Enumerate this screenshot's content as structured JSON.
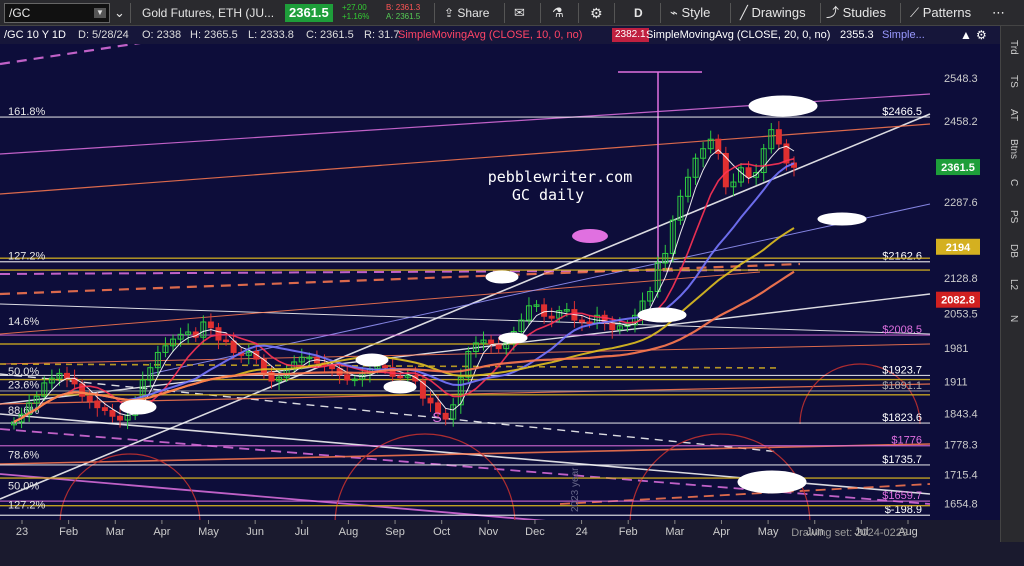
{
  "toolbar": {
    "symbol": "/GC",
    "instrument_name": "Gold Futures, ETH (JU...",
    "last_price": "2361.5",
    "change": "+27.00",
    "change_pct": "+1.16%",
    "bid": "B: 2361.3",
    "ask": "A: 2361.5",
    "share_label": "Share",
    "period_label": "D",
    "style_label": "Style",
    "drawings_label": "Drawings",
    "studies_label": "Studies",
    "patterns_label": "Patterns"
  },
  "study_bar": {
    "symbol_period": "/GC 10 Y 1D",
    "date": "D: 5/28/24",
    "open": "O: 2338",
    "high": "H: 2365.5",
    "low": "L: 2333.8",
    "close": "C: 2361.5",
    "range": "R: 31.7",
    "sma10_label": "SimpleMovingAvg (CLOSE, 10, 0, no)",
    "sma10_value": "2382.1",
    "sma20_label": "SimpleMovingAvg (CLOSE, 20, 0, no)",
    "sma20_value": "2355.3",
    "more_label": "Simple..."
  },
  "sidebar_tabs": [
    "Trd",
    "TS",
    "AT",
    "Btns",
    "C",
    "PS",
    "DB",
    "L2",
    "N"
  ],
  "drawing_set": "Drawing set: 2024-0229",
  "annotations": {
    "watermark_line1": "pebblewriter.com",
    "watermark_line2": "GC daily",
    "s_marker": "S",
    "vertical_year": "2023 year"
  },
  "colors": {
    "background": "#0d0d3a",
    "up_candle": "#2ecc40",
    "down_candle": "#e03030",
    "sma10": "#ff3355",
    "sma20": "#7777ff",
    "price_badge": "#1e9e3a",
    "fib_pink": "#e070e0",
    "fib_yellow": "#d4b020",
    "trend_white": "#ffffff",
    "trend_orange": "#ff7a50",
    "sma_yellow": "#e0c020"
  },
  "chart_data": {
    "type": "candlestick",
    "x_tick_labels": [
      "23",
      "Feb",
      "Mar",
      "Apr",
      "May",
      "Jun",
      "Jul",
      "Aug",
      "Sep",
      "Oct",
      "Nov",
      "Dec",
      "24",
      "Feb",
      "Mar",
      "Apr",
      "May",
      "Jun",
      "Jul",
      "Aug"
    ],
    "y_tick_labels": [
      "2548.3",
      "2458.2",
      "2287.6",
      "2128.8",
      "2053.5",
      "1981",
      "1911",
      "1843.4",
      "1778.3",
      "1715.4",
      "1654.8"
    ],
    "ylim": [
      1620,
      2620
    ],
    "price_levels": [
      {
        "label": "$2466.5",
        "value": 2466.5,
        "color": "#ffffff"
      },
      {
        "label": "$2162.6",
        "value": 2162.6,
        "color": "#ffffff"
      },
      {
        "label": "$2008.5",
        "value": 2008.5,
        "color": "#e070e0"
      },
      {
        "label": "$1923.7",
        "value": 1923.7,
        "color": "#ffffff"
      },
      {
        "label": "$1891.1",
        "value": 1891.1,
        "color": "#aaaaaa"
      },
      {
        "label": "$1823.6",
        "value": 1823.6,
        "color": "#ffffff"
      },
      {
        "label": "$1776",
        "value": 1776,
        "color": "#e070e0"
      },
      {
        "label": "$1735.7",
        "value": 1735.7,
        "color": "#ffffff"
      },
      {
        "label": "$1659.7",
        "value": 1659.7,
        "color": "#e070e0"
      },
      {
        "label": "$-198.9",
        "value": 1630,
        "color": "#ffffff"
      }
    ],
    "fib_labels": [
      {
        "label": "161.8%",
        "value": 2466.5
      },
      {
        "label": "127.2%",
        "value": 2162.6
      },
      {
        "label": "14.6%",
        "value": 2025
      },
      {
        "label": "50.0%",
        "value": 1920
      },
      {
        "label": "23.6%",
        "value": 1892
      },
      {
        "label": "88.6%",
        "value": 1838
      },
      {
        "label": "78.6%",
        "value": 1745
      },
      {
        "label": "50.0%",
        "value": 1680
      },
      {
        "label": "127.2%",
        "value": 1640
      }
    ],
    "price_badges": [
      {
        "label": "2361.5",
        "value": 2361.5,
        "color": "#1e9e3a"
      },
      {
        "label": "2194",
        "value": 2194,
        "color": "#d4b020"
      },
      {
        "label": "2082.8",
        "value": 2082.8,
        "color": "#d02020"
      }
    ],
    "closes": [
      1826,
      1842,
      1866,
      1880,
      1908,
      1918,
      1928,
      1918,
      1906,
      1880,
      1870,
      1856,
      1850,
      1838,
      1830,
      1840,
      1866,
      1914,
      1940,
      1972,
      1986,
      2000,
      2010,
      2015,
      2004,
      2036,
      2024,
      1998,
      1996,
      1972,
      1966,
      1974,
      1958,
      1930,
      1912,
      1920,
      1938,
      1952,
      1962,
      1962,
      1950,
      1944,
      1938,
      1925,
      1914,
      1916,
      1928,
      1938,
      1944,
      1940,
      1922,
      1920,
      1924,
      1912,
      1876,
      1866,
      1844,
      1832,
      1862,
      1920,
      1974,
      1992,
      1998,
      1990,
      1980,
      1992,
      2016,
      2040,
      2070,
      2072,
      2048,
      2044,
      2060,
      2062,
      2040,
      2036,
      2034,
      2050,
      2034,
      2020,
      2028,
      2030,
      2050,
      2080,
      2100,
      2160,
      2180,
      2250,
      2300,
      2340,
      2380,
      2400,
      2420,
      2390,
      2320,
      2330,
      2360,
      2340,
      2350,
      2400,
      2440,
      2410,
      2370,
      2361
    ]
  }
}
